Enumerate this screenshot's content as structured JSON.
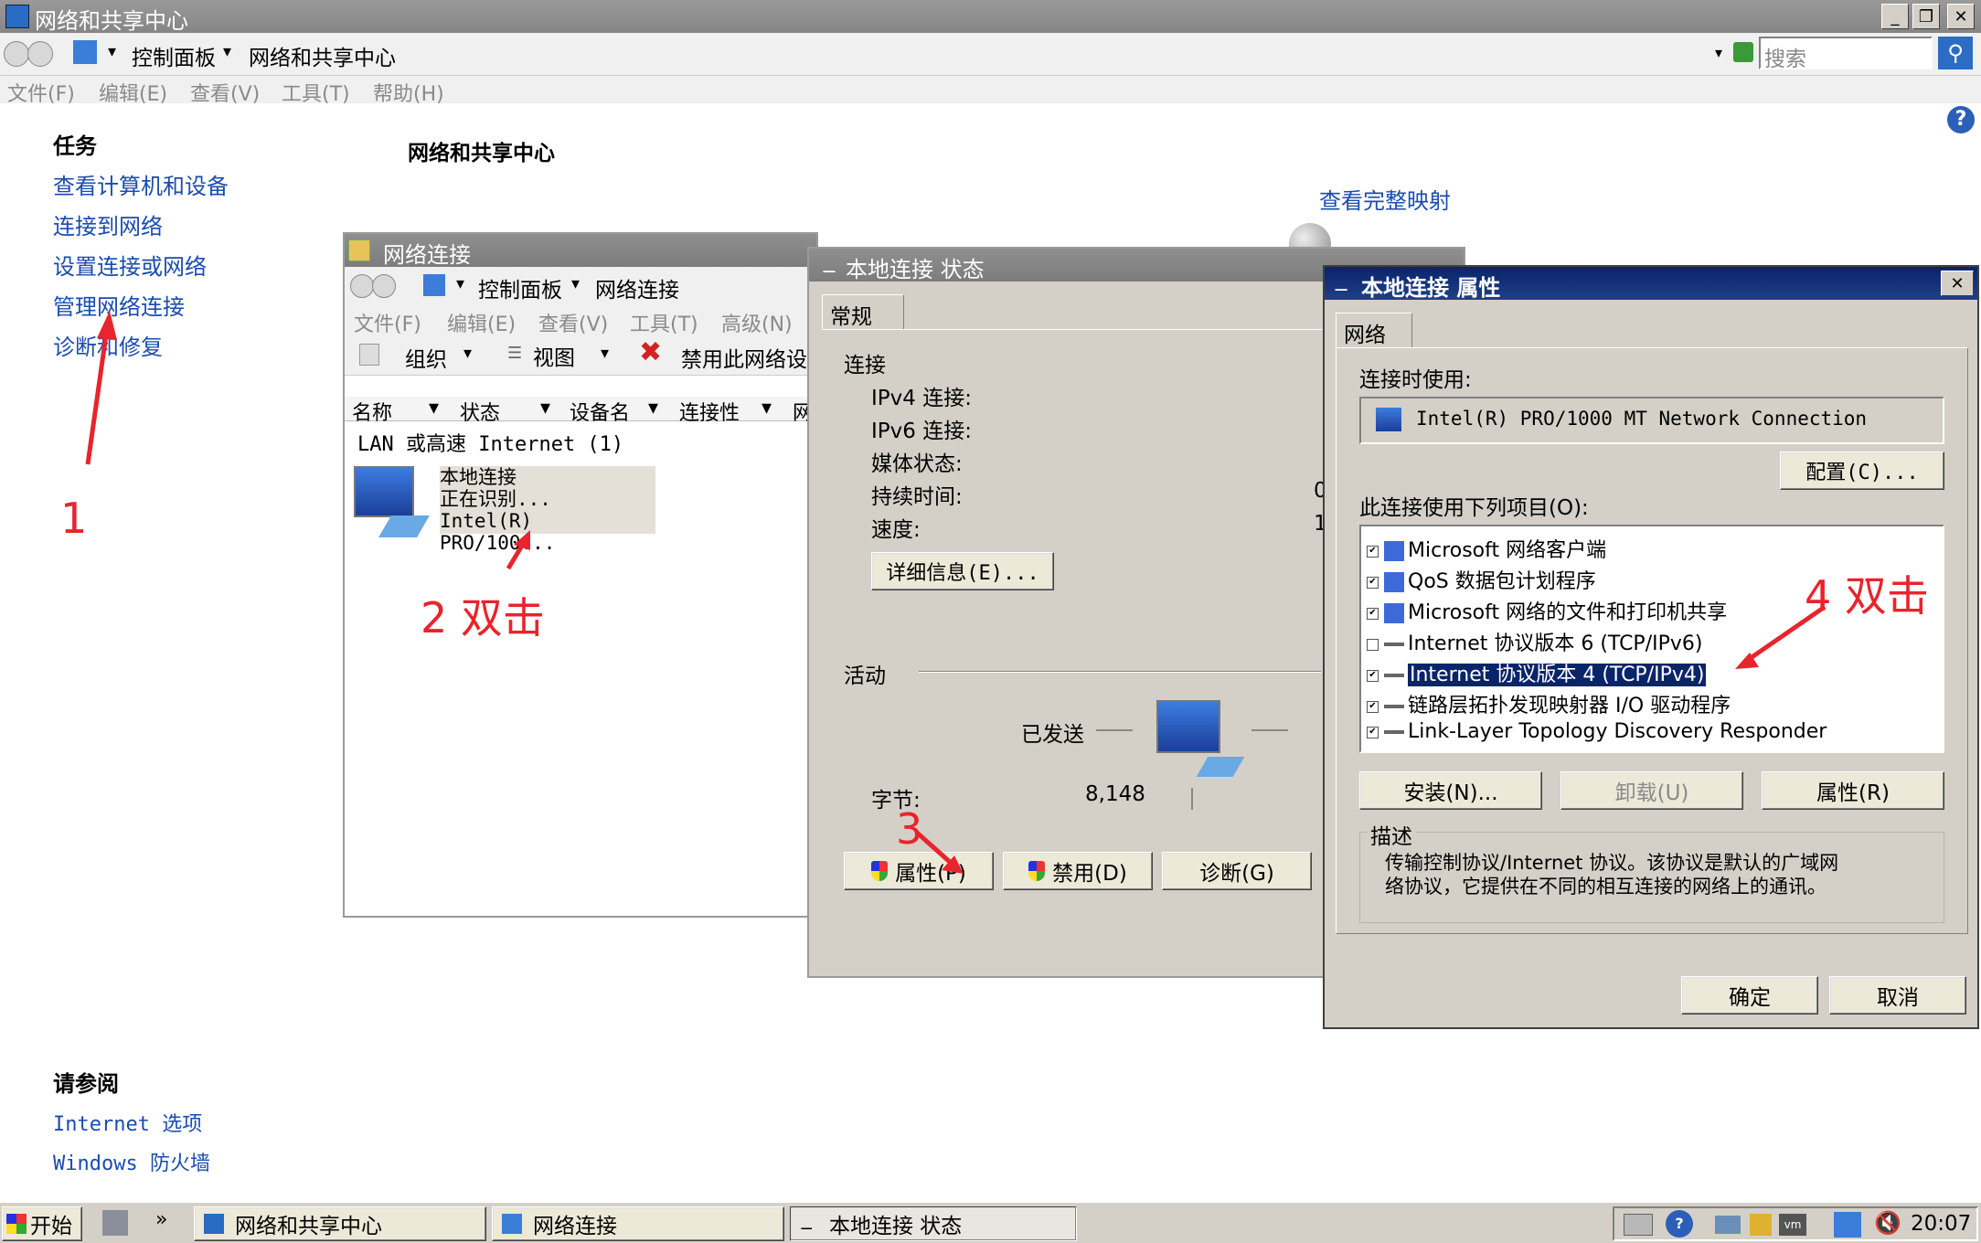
{
  "main_window": {
    "title": "网络和共享中心",
    "breadcrumb": [
      "控制面板",
      "网络和共享中心"
    ],
    "search_placeholder": "搜索",
    "menu": [
      "文件(F)",
      "编辑(E)",
      "查看(V)",
      "工具(T)",
      "帮助(H)"
    ],
    "tasks_heading": "任务",
    "tasks": [
      "查看计算机和设备",
      "连接到网络",
      "设置连接或网络",
      "管理网络连接",
      "诊断和修复"
    ],
    "page_title": "网络和共享中心",
    "full_map_link": "查看完整映射",
    "see_also_heading": "请参阅",
    "see_also": [
      "Internet 选项",
      "Windows 防火墙"
    ]
  },
  "net_conn_window": {
    "title": "网络连接",
    "breadcrumb": [
      "控制面板",
      "网络连接"
    ],
    "menu": [
      "文件(F)",
      "编辑(E)",
      "查看(V)",
      "工具(T)",
      "高级(N)"
    ],
    "toolbar": {
      "organize": "组织",
      "view": "视图",
      "disable": "禁用此网络设"
    },
    "columns": [
      "名称",
      "状态",
      "设备名",
      "连接性",
      "网"
    ],
    "group": "LAN 或高速 Internet (1)",
    "item": {
      "name": "本地连接",
      "status": "正在识别...",
      "device": "Intel(R) PRO/100..."
    }
  },
  "status_dialog": {
    "title": "本地连接 状态",
    "tab": "常规",
    "connection_heading": "连接",
    "rows": [
      {
        "label": "IPv4 连接:",
        "value": ""
      },
      {
        "label": "IPv6 连接:",
        "value": ""
      },
      {
        "label": "媒体状态:",
        "value": ""
      },
      {
        "label": "持续时间:",
        "value": "0"
      },
      {
        "label": "速度:",
        "value": "1"
      }
    ],
    "details_button": "详细信息(E)...",
    "activity_heading": "活动",
    "sent_label": "已发送",
    "bytes_label": "字节:",
    "bytes_sent": "8,148",
    "buttons": [
      "属性(P)",
      "禁用(D)",
      "诊断(G)"
    ]
  },
  "props_dialog": {
    "title": "本地连接 属性",
    "tab": "网络",
    "connect_using_label": "连接时使用:",
    "adapter": "Intel(R) PRO/1000 MT Network Connection",
    "configure_button": "配置(C)...",
    "items_label": "此连接使用下列项目(O):",
    "items": [
      {
        "label": "Microsoft 网络客户端",
        "checked": true,
        "selected": false
      },
      {
        "label": "QoS 数据包计划程序",
        "checked": true,
        "selected": false
      },
      {
        "label": "Microsoft 网络的文件和打印机共享",
        "checked": true,
        "selected": false
      },
      {
        "label": "Internet 协议版本 6 (TCP/IPv6)",
        "checked": false,
        "selected": false
      },
      {
        "label": "Internet 协议版本 4 (TCP/IPv4)",
        "checked": true,
        "selected": true
      },
      {
        "label": "链路层拓扑发现映射器 I/O 驱动程序",
        "checked": true,
        "selected": false
      },
      {
        "label": "Link-Layer Topology Discovery Responder",
        "checked": true,
        "selected": false
      }
    ],
    "install_button": "安装(N)...",
    "uninstall_button": "卸载(U)",
    "properties_button": "属性(R)",
    "description_heading": "描述",
    "description_line1": "传输控制协议/Internet 协议。该协议是默认的广域网",
    "description_line2": "络协议，它提供在不同的相互连接的网络上的通讯。",
    "ok_button": "确定",
    "cancel_button": "取消"
  },
  "annotations": {
    "step1": "1",
    "step2": "2 双击",
    "step3": "3",
    "step4": "4 双击"
  },
  "taskbar": {
    "start": "开始",
    "tasks": [
      "网络和共享中心",
      "网络连接",
      "本地连接 状态"
    ],
    "clock": "20:07"
  },
  "colors": {
    "annotation_red": "#e8242c",
    "selection_blue": "#0a246a",
    "link_blue": "#1a4cb0"
  }
}
